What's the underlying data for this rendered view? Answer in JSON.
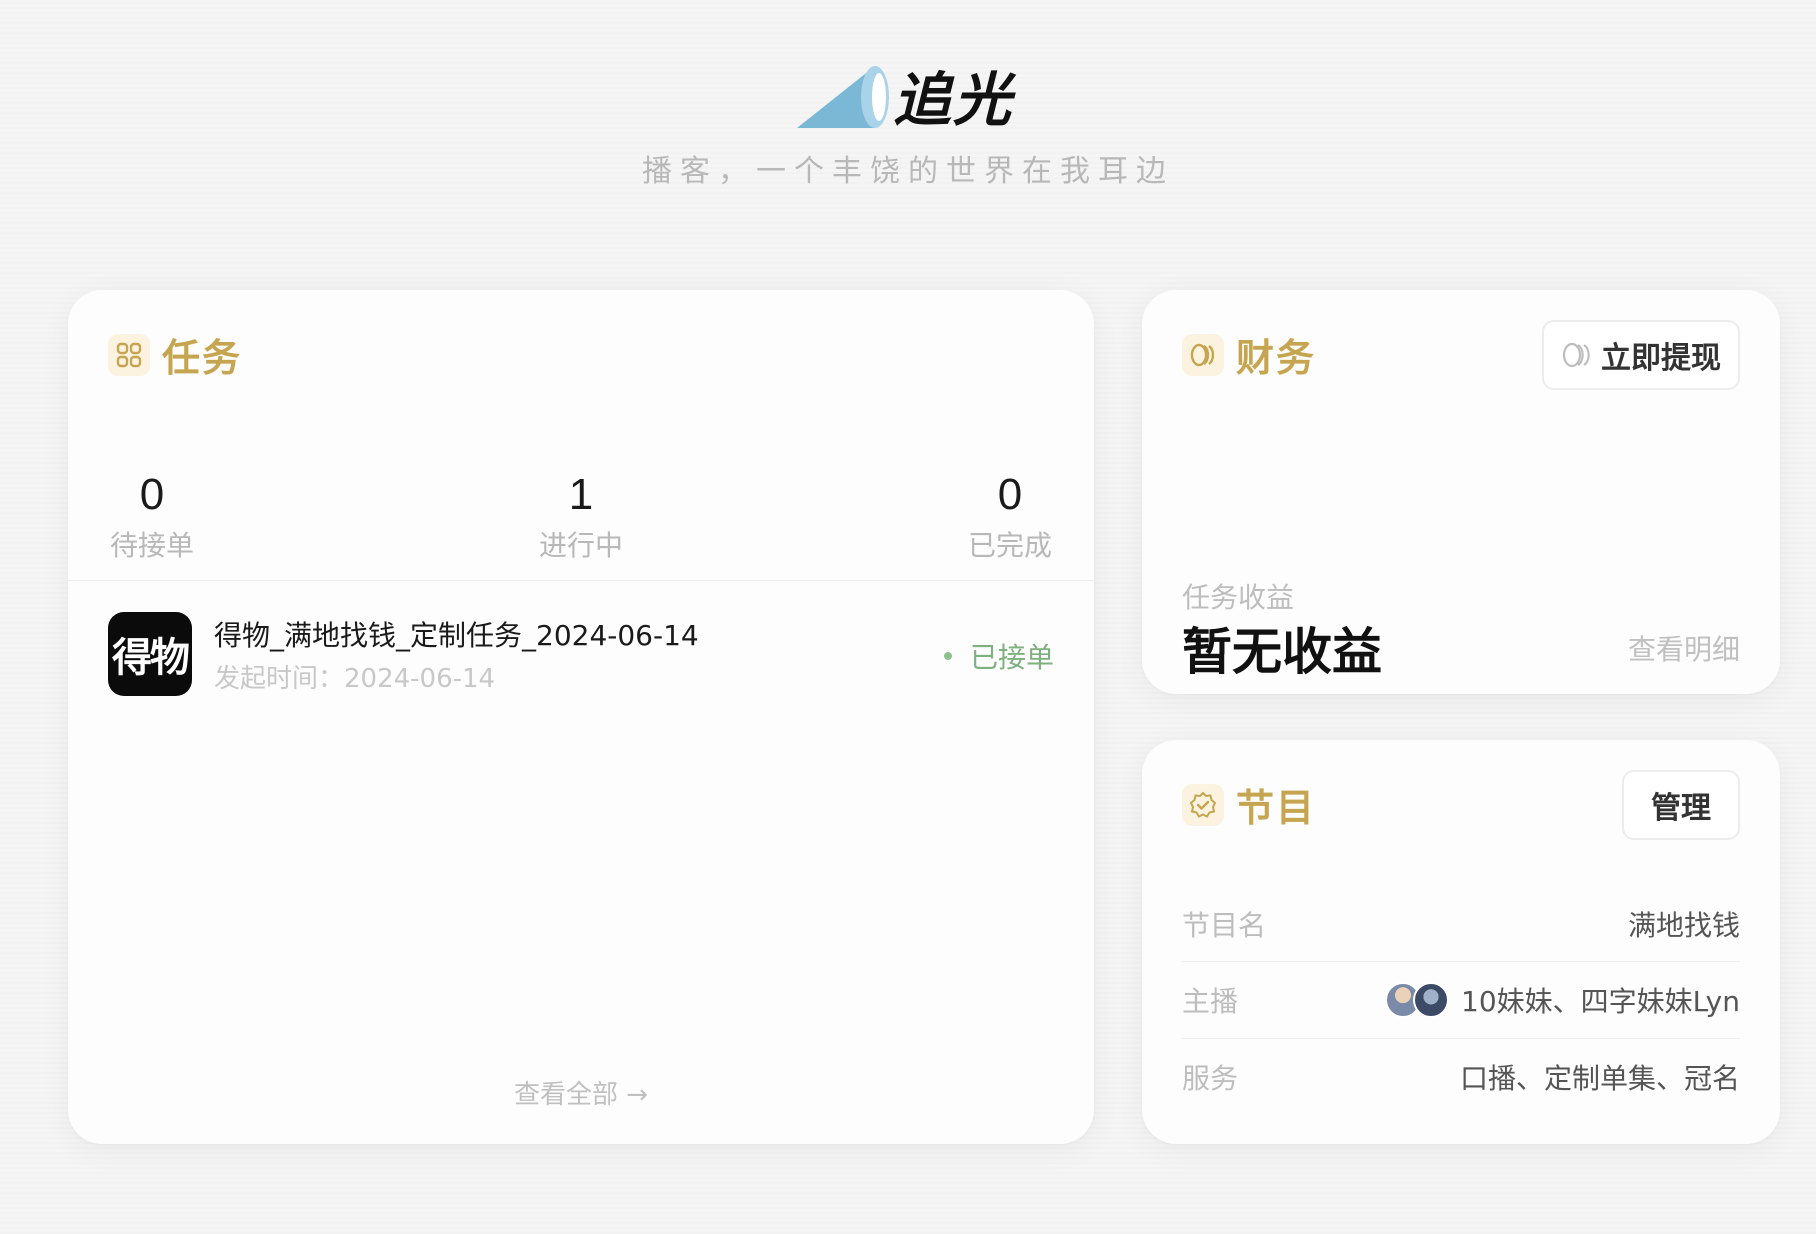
{
  "brand": {
    "name": "追光",
    "slogan": "播客，一个丰饶的世界在我耳边",
    "logo_icon": "spotlight-icon"
  },
  "tasks": {
    "title": "任务",
    "icon": "grid-icon",
    "stats": [
      {
        "value": "0",
        "label": "待接单"
      },
      {
        "value": "1",
        "label": "进行中"
      },
      {
        "value": "0",
        "label": "已完成"
      }
    ],
    "items": [
      {
        "logo_text": "得物",
        "name": "得物_满地找钱_定制任务_2024-06-14",
        "date": "发起时间：2024-06-14",
        "status": "已接单"
      }
    ],
    "view_all": "查看全部 →"
  },
  "finance": {
    "title": "财务",
    "icon": "coins-icon",
    "withdraw_label": "立即提现",
    "income_label": "任务收益",
    "income_value": "暂无收益",
    "detail_link": "查看明细"
  },
  "program": {
    "title": "节目",
    "icon": "badge-check-icon",
    "manage_label": "管理",
    "rows": [
      {
        "label": "节目名",
        "value": "满地找钱"
      },
      {
        "label": "主播",
        "value": "10妹妹、四字妹妹Lyn"
      },
      {
        "label": "服务",
        "value": "口播、定制单集、冠名"
      }
    ]
  },
  "colors": {
    "accent_gold": "#c6a550",
    "status_green": "#7fb07f",
    "logo_blue": "#7bb8d6"
  }
}
